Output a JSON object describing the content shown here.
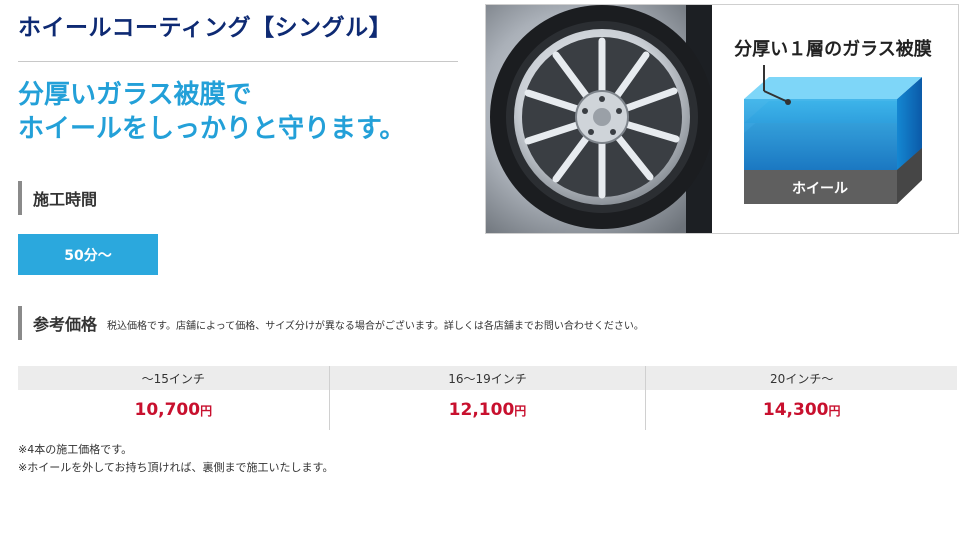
{
  "title": "ホイールコーティング【シングル】",
  "lead": {
    "line1": "分厚いガラス被膜で",
    "line2": "ホイールをしっかりと守ります。"
  },
  "construction_time": {
    "label": "施工時間",
    "value": "50分～"
  },
  "reference_price": {
    "label": "参考価格",
    "note": "税込価格です。店舗によって価格、サイズ分けが異なる場合がございます。詳しくは各店舗までお問い合わせください。",
    "columns": [
      {
        "size": "～15インチ",
        "price": "10,700",
        "unit": "円"
      },
      {
        "size": "16～19インチ",
        "price": "12,100",
        "unit": "円"
      },
      {
        "size": "20インチ～",
        "price": "14,300",
        "unit": "円"
      }
    ]
  },
  "notes": [
    "※4本の施工価格です。",
    "※ホイールを外してお持ち頂ければ、裏側まで施工いたします。"
  ],
  "illustration": {
    "callout": "分厚い１層のガラス被膜",
    "base_label": "ホイール"
  },
  "colors": {
    "title": "#0e2a73",
    "accent": "#23a0d8",
    "badge": "#2ba8dd",
    "price": "#c8102e",
    "table_header": "#ececec"
  }
}
